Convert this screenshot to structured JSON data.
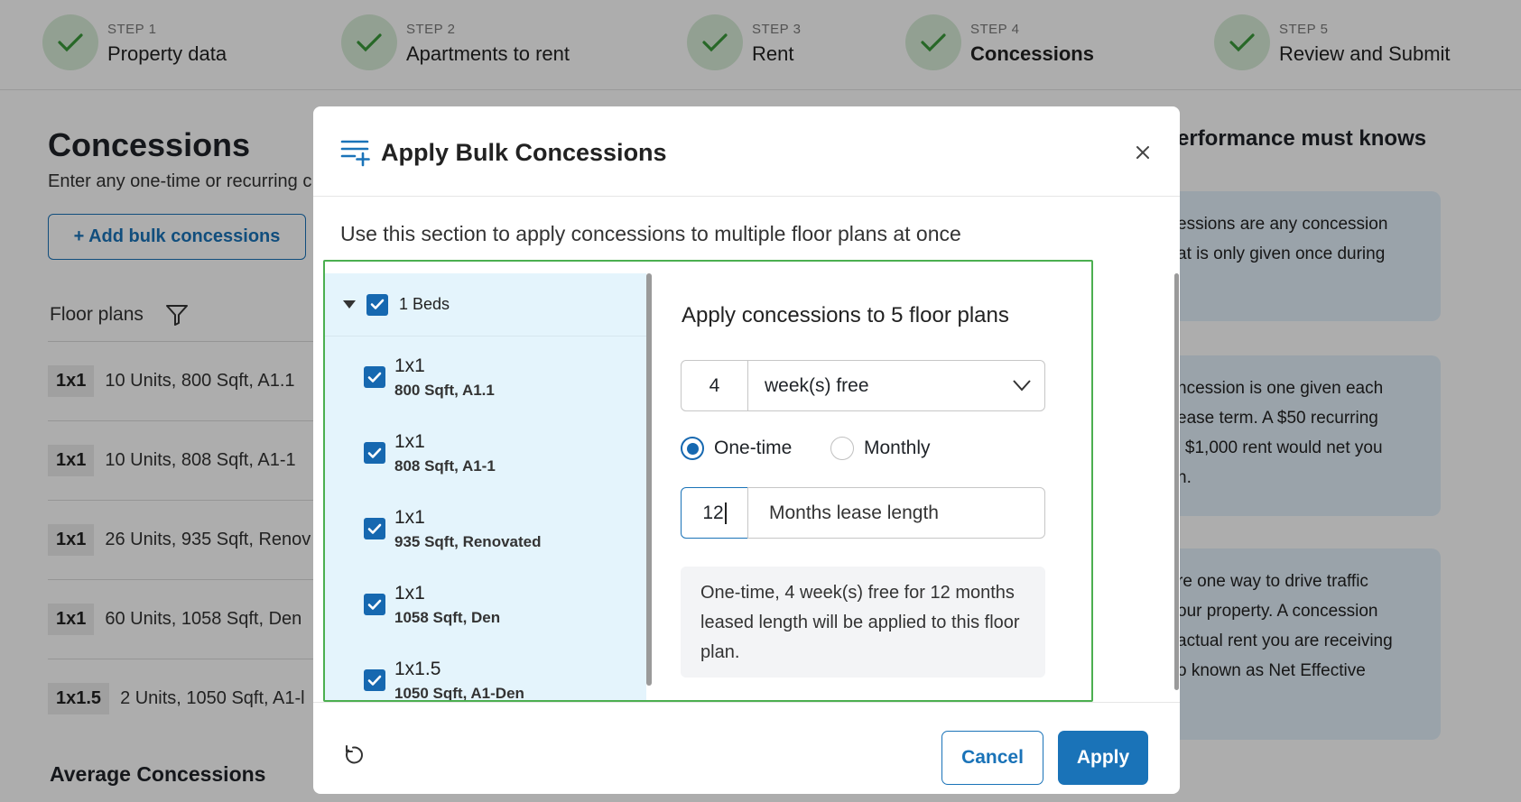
{
  "stepper": {
    "steps": [
      {
        "num": "STEP 1",
        "title": "Property data"
      },
      {
        "num": "STEP 2",
        "title": "Apartments to rent"
      },
      {
        "num": "STEP 3",
        "title": "Rent"
      },
      {
        "num": "STEP 4",
        "title": "Concessions"
      },
      {
        "num": "STEP 5",
        "title": "Review and Submit"
      }
    ],
    "active_step": 4
  },
  "page": {
    "title": "Concessions",
    "subtitle": "Enter any one-time or recurring c",
    "bulk_button": "+ Add bulk concessions",
    "floor_plans_label": "Floor plans",
    "floor_plans": [
      {
        "badge": "1x1",
        "desc": "10 Units, 800 Sqft, A1.1"
      },
      {
        "badge": "1x1",
        "desc": "10 Units, 808 Sqft, A1-1"
      },
      {
        "badge": "1x1",
        "desc": "26 Units, 935 Sqft, Renov"
      },
      {
        "badge": "1x1",
        "desc": "60 Units, 1058 Sqft, Den"
      },
      {
        "badge": "1x1.5",
        "desc": "2 Units, 1050 Sqft, A1-l"
      }
    ],
    "average_title": "Average Concessions"
  },
  "right_panel": {
    "title": "erformance must knows",
    "cards": [
      {
        "lines": [
          "essions are any concession",
          "at is only given once during"
        ]
      },
      {
        "lines": [
          "ncession is one given each",
          "ease term. A $50 recurring",
          "' $1,000 rent would net you",
          "h."
        ]
      },
      {
        "lines": [
          "re one way to drive traffic",
          "our property. A concession",
          "actual rent you are receiving",
          "o known as Net Effective"
        ]
      }
    ]
  },
  "modal": {
    "title": "Apply Bulk Concessions",
    "description": "Use this section to apply concessions to multiple floor plans at once",
    "group": {
      "label": "1 Beds",
      "checked": true,
      "expanded": true
    },
    "plans": [
      {
        "name": "1x1",
        "sub": "800 Sqft, A1.1",
        "checked": true
      },
      {
        "name": "1x1",
        "sub": "808 Sqft, A1-1",
        "checked": true
      },
      {
        "name": "1x1",
        "sub": "935 Sqft, Renovated",
        "checked": true
      },
      {
        "name": "1x1",
        "sub": "1058 Sqft, Den",
        "checked": true
      },
      {
        "name": "1x1.5",
        "sub": "1050 Sqft, A1-Den",
        "checked": true
      }
    ],
    "apply_title": "Apply concessions to 5 floor plans",
    "quantity": "4",
    "unit_select": "week(s) free",
    "frequency": {
      "selected": "One-time",
      "options": [
        "One-time",
        "Monthly"
      ]
    },
    "lease_length": "12",
    "lease_label": "Months lease length",
    "summary": "One-time, 4 week(s) free for 12 months leased length will be applied to this floor plan.",
    "cancel_label": "Cancel",
    "apply_label": "Apply"
  },
  "colors": {
    "accent": "#1a73b8",
    "checkbox": "#1668b0",
    "step_done_bg": "#d8ecd8",
    "step_check": "#3a9a3a",
    "list_bg": "#e4f4fc",
    "frame_green": "#4caf50"
  },
  "icons": {
    "step": "checkmark-icon",
    "filter": "filter-icon",
    "modal": "list-add-icon",
    "close": "close-icon",
    "dropdown": "chevron-down-icon",
    "reset": "reset-icon"
  }
}
